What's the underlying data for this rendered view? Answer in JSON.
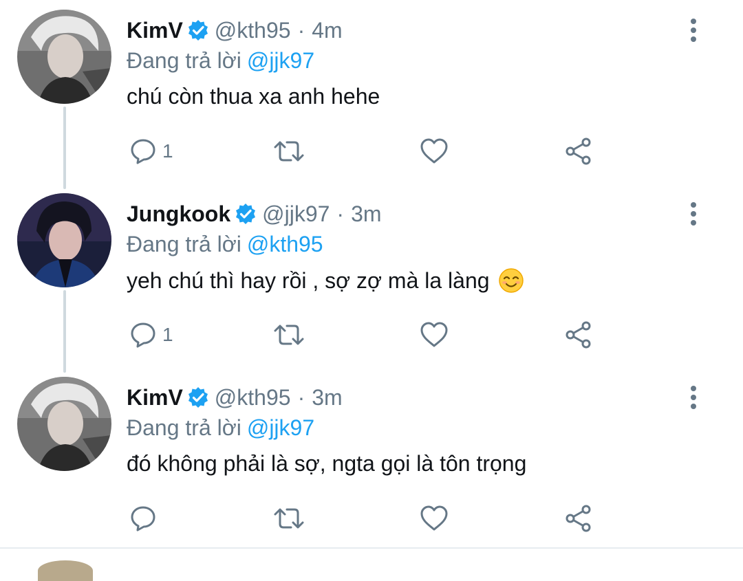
{
  "tweets": [
    {
      "display_name": "KimV",
      "handle": "@kth95",
      "separator": "·",
      "time": "4m",
      "replying_label": "Đang trả lời",
      "replying_to": "@jjk97",
      "text": "chú còn thua xa anh hehe",
      "reply_count": "1",
      "avatar_icon": "avatar-photo",
      "verified": true
    },
    {
      "display_name": "Jungkook",
      "handle": "@jjk97",
      "separator": "·",
      "time": "3m",
      "replying_label": "Đang trả lời",
      "replying_to": "@kth95",
      "text": "yeh chú thì hay rồi , sợ zợ mà la làng",
      "emoji": "smiling-face-emoji",
      "reply_count": "1",
      "avatar_icon": "avatar-photo",
      "verified": true
    },
    {
      "display_name": "KimV",
      "handle": "@kth95",
      "separator": "·",
      "time": "3m",
      "replying_label": "Đang trả lời",
      "replying_to": "@jjk97",
      "text": "đó không phải là sợ, ngta gọi là tôn trọng",
      "reply_count": "",
      "avatar_icon": "avatar-photo",
      "verified": true
    }
  ],
  "icons": {
    "reply": "reply-icon",
    "retweet": "retweet-icon",
    "like": "heart-icon",
    "share": "share-icon",
    "more": "more-vertical-icon",
    "verified": "verified-badge-icon"
  },
  "colors": {
    "accent": "#1da1f2",
    "text_primary": "#111418",
    "text_secondary": "#657786",
    "thread_line": "#cfd9de",
    "divider": "#e6ecf0"
  }
}
